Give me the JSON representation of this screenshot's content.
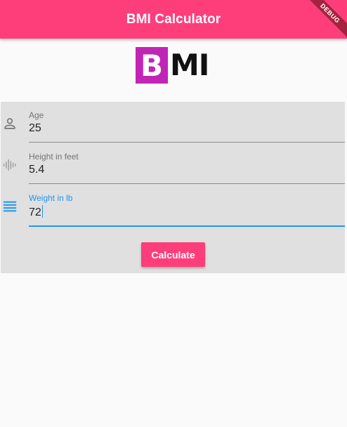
{
  "appbar": {
    "title": "BMI Calculator",
    "color": "#fd3e7b"
  },
  "debug_banner": "DEBUG",
  "logo": {
    "letter_b": "B",
    "letters_mi": "MI",
    "b_background": "#c125b6"
  },
  "form": {
    "fields": [
      {
        "label": "Age",
        "value": "25",
        "icon": "person-outline-icon",
        "focused": false
      },
      {
        "label": "Height in feet",
        "value": "5.4",
        "icon": "graphic-eq-icon",
        "focused": false
      },
      {
        "label": "Weight in lb",
        "value": "72",
        "icon": "menu-lines-icon",
        "focused": true
      }
    ],
    "accent_color": "#2196f3"
  },
  "calculate_button": {
    "label": "Calculate"
  }
}
